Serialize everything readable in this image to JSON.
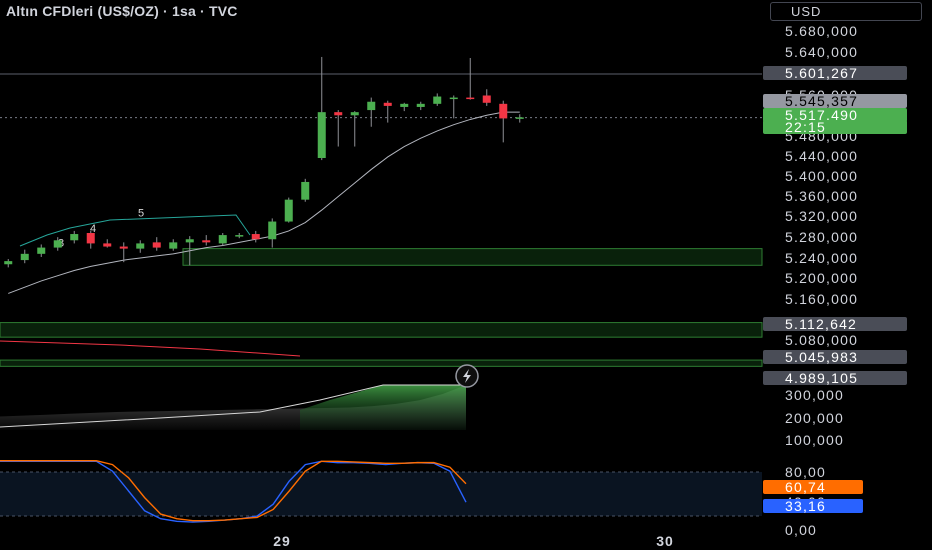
{
  "header": {
    "title": "Altın CFDleri (US$/OZ) · 1sa · TVC",
    "currency": "USD"
  },
  "price_axis": {
    "ticks": [
      "5.680,000",
      "5.640,000",
      "5.560,000",
      "5.480,000",
      "5.440,000",
      "5.400,000",
      "5.360,000",
      "5.320,000",
      "5.280,000",
      "5.240,000",
      "5.200,000",
      "5.160,000",
      "5.080,000"
    ],
    "tags": [
      {
        "label": "5.601,267",
        "kind": "grey"
      },
      {
        "label": "5.545,357",
        "kind": "grey"
      },
      {
        "label": "5.517,490",
        "kind": "green"
      },
      {
        "label": "22:15",
        "kind": "green"
      },
      {
        "label": "5.112,642",
        "kind": "grey"
      },
      {
        "label": "5.045,983",
        "kind": "grey"
      },
      {
        "label": "4.989,105",
        "kind": "grey"
      }
    ]
  },
  "volume_axis": {
    "ticks": [
      "300,000",
      "200,000",
      "100,000"
    ]
  },
  "osc_axis": {
    "ticks": [
      "80,00",
      "40,00",
      "0,00"
    ],
    "tags": [
      {
        "label": "60,74",
        "color": "#ff6d00"
      },
      {
        "label": "33,16",
        "color": "#2962ff"
      }
    ]
  },
  "time_axis": {
    "labels": [
      "29",
      "30"
    ]
  },
  "colors": {
    "up": "#4caf50",
    "down": "#f23645",
    "zone": "#1b5e20",
    "k_line": "#2962ff",
    "d_line": "#ff6d00",
    "band": "#1e3a5f",
    "ma": "#b2b5be"
  },
  "chart_data": [
    {
      "type": "candlestick",
      "title": "Altın CFDleri (US$/OZ) · 1sa · TVC",
      "ylim": [
        4960,
        5700
      ],
      "x_labels": {
        "29": 17,
        "30": 40
      },
      "candles": [
        {
          "o": 5236,
          "h": 5246,
          "l": 5230,
          "c": 5242
        },
        {
          "o": 5244,
          "h": 5264,
          "l": 5238,
          "c": 5256
        },
        {
          "o": 5256,
          "h": 5274,
          "l": 5250,
          "c": 5268
        },
        {
          "o": 5268,
          "h": 5288,
          "l": 5262,
          "c": 5282
        },
        {
          "o": 5282,
          "h": 5300,
          "l": 5276,
          "c": 5294
        },
        {
          "o": 5296,
          "h": 5300,
          "l": 5266,
          "c": 5276
        },
        {
          "o": 5276,
          "h": 5284,
          "l": 5268,
          "c": 5270
        },
        {
          "o": 5270,
          "h": 5278,
          "l": 5240,
          "c": 5266
        },
        {
          "o": 5266,
          "h": 5282,
          "l": 5258,
          "c": 5276
        },
        {
          "o": 5278,
          "h": 5288,
          "l": 5262,
          "c": 5268
        },
        {
          "o": 5266,
          "h": 5284,
          "l": 5262,
          "c": 5278
        },
        {
          "o": 5278,
          "h": 5290,
          "l": 5234,
          "c": 5284
        },
        {
          "o": 5282,
          "h": 5292,
          "l": 5272,
          "c": 5278
        },
        {
          "o": 5276,
          "h": 5296,
          "l": 5272,
          "c": 5292
        },
        {
          "o": 5290,
          "h": 5296,
          "l": 5286,
          "c": 5292
        },
        {
          "o": 5294,
          "h": 5300,
          "l": 5278,
          "c": 5284
        },
        {
          "o": 5284,
          "h": 5324,
          "l": 5268,
          "c": 5318
        },
        {
          "o": 5318,
          "h": 5364,
          "l": 5316,
          "c": 5360
        },
        {
          "o": 5360,
          "h": 5400,
          "l": 5356,
          "c": 5394
        },
        {
          "o": 5440,
          "h": 5634,
          "l": 5436,
          "c": 5528
        },
        {
          "o": 5528,
          "h": 5532,
          "l": 5462,
          "c": 5522
        },
        {
          "o": 5522,
          "h": 5530,
          "l": 5462,
          "c": 5528
        },
        {
          "o": 5532,
          "h": 5556,
          "l": 5500,
          "c": 5548
        },
        {
          "o": 5546,
          "h": 5550,
          "l": 5508,
          "c": 5540
        },
        {
          "o": 5538,
          "h": 5546,
          "l": 5530,
          "c": 5544
        },
        {
          "o": 5538,
          "h": 5548,
          "l": 5532,
          "c": 5544
        },
        {
          "o": 5544,
          "h": 5564,
          "l": 5540,
          "c": 5558
        },
        {
          "o": 5556,
          "h": 5560,
          "l": 5516,
          "c": 5556
        },
        {
          "o": 5556,
          "h": 5632,
          "l": 5552,
          "c": 5554
        },
        {
          "o": 5560,
          "h": 5572,
          "l": 5540,
          "c": 5546
        },
        {
          "o": 5544,
          "h": 5550,
          "l": 5470,
          "c": 5516
        },
        {
          "o": 5516,
          "h": 5524,
          "l": 5508,
          "c": 5518
        }
      ],
      "moving_average": [
        5180,
        5192,
        5204,
        5214,
        5224,
        5232,
        5238,
        5244,
        5248,
        5252,
        5256,
        5262,
        5268,
        5272,
        5278,
        5284,
        5290,
        5300,
        5316,
        5340,
        5366,
        5392,
        5418,
        5442,
        5462,
        5478,
        5492,
        5504,
        5514,
        5522,
        5528,
        5528
      ],
      "wave_labels": [
        {
          "label": "3",
          "at_index": 2,
          "y": 5270
        },
        {
          "label": "4",
          "at_index": 4,
          "y": 5298
        },
        {
          "label": "5",
          "at_index": 7,
          "y": 5328
        }
      ],
      "zones": [
        {
          "top": 5266,
          "bottom": 5234
        },
        {
          "top": 5124,
          "bottom": 5096
        },
        {
          "top": 5052,
          "bottom": 5040
        }
      ],
      "horizontal_lines": [
        5601.267
      ],
      "dotted_lines": [
        5517.49
      ]
    },
    {
      "type": "area",
      "series": [
        {
          "values": [
            0.3,
            0.32,
            0.34,
            0.36,
            0.38,
            0.4,
            0.41,
            0.42,
            0.43,
            0.44,
            0.45,
            0.46,
            0.47,
            0.48,
            0.49,
            0.5,
            0.53,
            0.58,
            0.66,
            0.8,
            1.0
          ]
        }
      ],
      "ylim": [
        0,
        350000
      ]
    },
    {
      "type": "line",
      "ylim": [
        0,
        100
      ],
      "band": [
        20,
        80
      ],
      "series": [
        {
          "values": [
            95,
            95,
            95,
            95,
            95,
            95,
            95,
            80,
            50,
            20,
            8,
            4,
            3,
            4,
            6,
            8,
            12,
            30,
            65,
            90,
            95,
            93,
            93,
            92,
            90,
            92,
            93,
            92,
            80,
            33
          ]
        },
        {
          "values": [
            96,
            96,
            96,
            96,
            96,
            96,
            96,
            90,
            70,
            40,
            15,
            8,
            5,
            5,
            6,
            8,
            10,
            22,
            50,
            80,
            95,
            95,
            94,
            93,
            92,
            92,
            93,
            93,
            86,
            61
          ]
        }
      ]
    }
  ]
}
